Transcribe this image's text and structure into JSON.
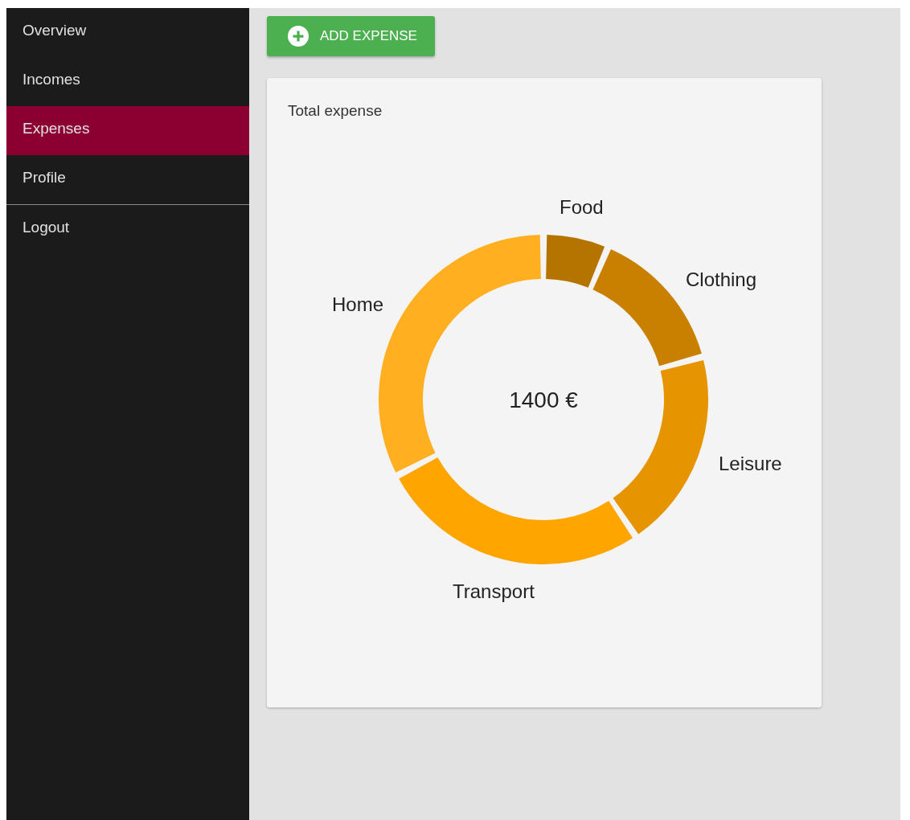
{
  "sidebar": {
    "items": [
      {
        "label": "Overview",
        "selected": false
      },
      {
        "label": "Incomes",
        "selected": false
      },
      {
        "label": "Expenses",
        "selected": true
      },
      {
        "label": "Profile",
        "selected": false
      }
    ],
    "footer_items": [
      {
        "label": "Logout",
        "selected": false
      }
    ]
  },
  "add_button": {
    "label": "ADD EXPENSE"
  },
  "card": {
    "title": "Total expense",
    "total": "1400 €",
    "slices": [
      {
        "label": "Food",
        "color": "#b57400"
      },
      {
        "label": "Clothing",
        "color": "#c98000"
      },
      {
        "label": "Leisure",
        "color": "#e69500"
      },
      {
        "label": "Transport",
        "color": "#ffa500"
      },
      {
        "label": "Home",
        "color": "#ffaf1f"
      }
    ]
  }
}
